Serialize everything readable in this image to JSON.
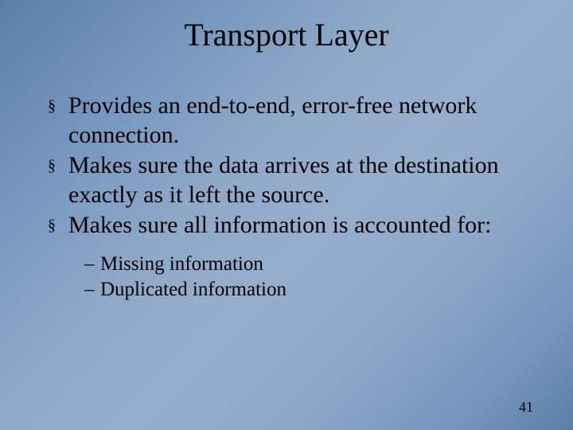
{
  "slide": {
    "title": "Transport Layer",
    "bullets": [
      {
        "text": "Provides an end-to-end, error-free network connection."
      },
      {
        "text": "Makes sure the data arrives at the destination exactly as it left the source."
      },
      {
        "text": "Makes sure all information is accounted for:"
      }
    ],
    "sub_bullets": [
      {
        "text": "Missing information"
      },
      {
        "text": "Duplicated information"
      }
    ],
    "page_number": "41",
    "marks": {
      "square": "§",
      "dash": "–"
    }
  }
}
